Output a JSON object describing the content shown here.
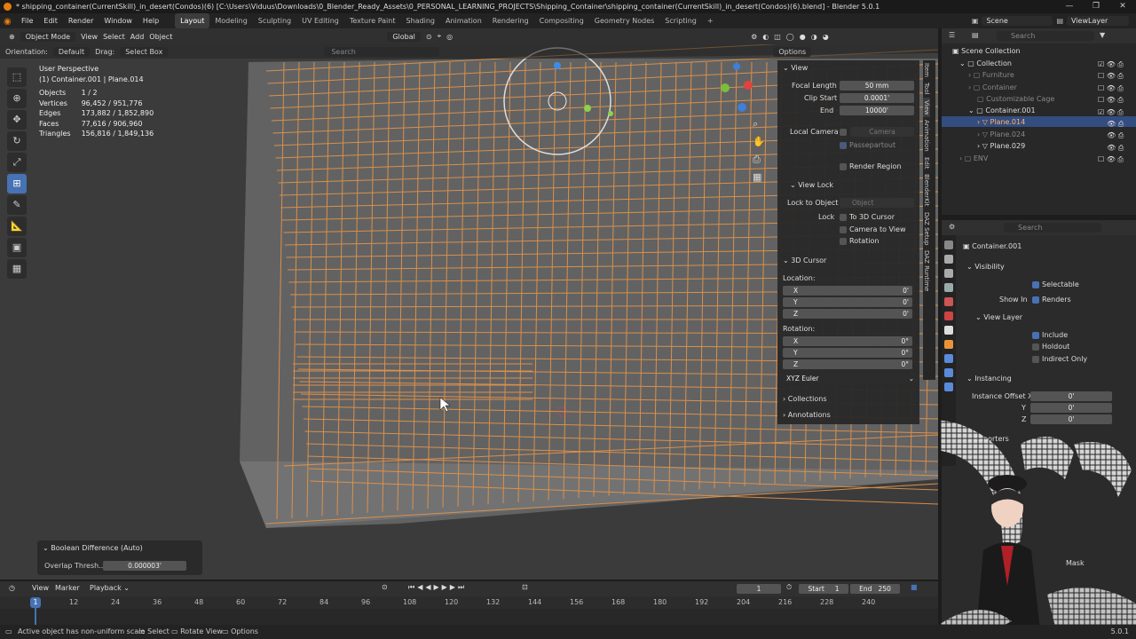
{
  "title": "* shipping_container(CurrentSkill)_in_desert(Condos)(6) [C:\\Users\\Viduus\\Downloads\\0_Blender_Ready_Assets\\0_PERSONAL_LEARNING_PROJECTS\\Shipping_Container\\shipping_container(CurrentSkill)_in_desert(Condos)(6).blend] - Blender 5.0.1",
  "window_controls": [
    "—",
    "❐",
    "✕"
  ],
  "menu": [
    "File",
    "Edit",
    "Render",
    "Window",
    "Help"
  ],
  "workspaces": [
    "Layout",
    "Modeling",
    "Sculpting",
    "UV Editing",
    "Texture Paint",
    "Shading",
    "Animation",
    "Rendering",
    "Compositing",
    "Geometry Nodes",
    "Scripting",
    "+"
  ],
  "scene": {
    "label": "Scene",
    "view_layer": "ViewLayer"
  },
  "viewport_header": {
    "mode": "Object Mode",
    "view": "View",
    "select": "Select",
    "add": "Add",
    "object": "Object",
    "transform": "Global"
  },
  "tool_settings": {
    "orientation_label": "Orientation:",
    "orientation": "Default",
    "drag_label": "Drag:",
    "drag": "Select Box",
    "search_placeholder": "Search",
    "options": "Options"
  },
  "overlay_info": {
    "perspective": "User Perspective",
    "object": "(1) Container.001 | Plane.014"
  },
  "stats": [
    {
      "label": "Objects",
      "value": "1 / 2"
    },
    {
      "label": "Vertices",
      "value": "96,452 / 951,776"
    },
    {
      "label": "Edges",
      "value": "173,882 / 1,852,890"
    },
    {
      "label": "Faces",
      "value": "77,616 / 906,960"
    },
    {
      "label": "Triangles",
      "value": "156,816 / 1,849,136"
    }
  ],
  "npanel": {
    "view_header": "View",
    "focal_label": "Focal Length",
    "focal_value": "50 mm",
    "clip_start_label": "Clip Start",
    "clip_start_value": "0.0001'",
    "end_label": "End",
    "end_value": "10000'",
    "local_camera_label": "Local Camera",
    "camera_placeholder": "Camera",
    "passepartout": "Passepartout",
    "render_region": "Render Region",
    "view_lock_header": "View Lock",
    "lock_object_label": "Lock to Object",
    "object_placeholder": "Object",
    "lock_label": "Lock",
    "to_3d_cursor": "To 3D Cursor",
    "camera_to_view": "Camera to View",
    "rotation_lock": "Rotation",
    "cursor_header": "3D Cursor",
    "location_label": "Location:",
    "loc": [
      {
        "axis": "X",
        "value": "0'"
      },
      {
        "axis": "Y",
        "value": "0'"
      },
      {
        "axis": "Z",
        "value": "0'"
      }
    ],
    "rotation_label": "Rotation:",
    "rot": [
      {
        "axis": "X",
        "value": "0°"
      },
      {
        "axis": "Y",
        "value": "0°"
      },
      {
        "axis": "Z",
        "value": "0°"
      }
    ],
    "euler": "XYZ Euler",
    "collections": "Collections",
    "annotations": "Annotations"
  },
  "ntabs": [
    "Item",
    "Tool",
    "View",
    "Animation",
    "Edit",
    "BlenderKit",
    "DAZ Setup",
    "DAZ Runtime"
  ],
  "outliner": {
    "search_placeholder": "Search",
    "items": [
      {
        "label": "Scene Collection"
      },
      {
        "label": "Collection"
      },
      {
        "label": "Furniture"
      },
      {
        "label": "Container"
      },
      {
        "label": "Customizable Cage"
      },
      {
        "label": "Container.001"
      },
      {
        "label": "Plane.014"
      },
      {
        "label": "Plane.024"
      },
      {
        "label": "Plane.029"
      },
      {
        "label": "ENV"
      }
    ]
  },
  "properties": {
    "search_placeholder": "Search",
    "object_name": "Container.001",
    "visibility": "Visibility",
    "selectable": "Selectable",
    "show_in": "Show In",
    "renders": "Renders",
    "view_layer": "View Layer",
    "include": "Include",
    "holdout": "Holdout",
    "indirect_only": "Indirect Only",
    "instancing": "Instancing",
    "instance_offset": "Instance Offset X",
    "y_label": "Y",
    "z_label": "Z",
    "offset_x": "0'",
    "offset_y": "0'",
    "offset_z": "0'",
    "exporters": "Exporters",
    "mask": "Mask"
  },
  "operator_panel": {
    "title": "Boolean Difference (Auto)",
    "label": "Overlap Thresh...",
    "value": "0.000003'"
  },
  "timeline": {
    "view": "View",
    "marker": "Marker",
    "playback": "Playback",
    "current_frame": "1",
    "start_label": "Start",
    "start": "1",
    "end_label": "End",
    "end": "250",
    "ticks": [
      "12",
      "24",
      "36",
      "48",
      "60",
      "72",
      "84",
      "96",
      "108",
      "120",
      "132",
      "144",
      "156",
      "168",
      "180",
      "192",
      "204",
      "216",
      "228",
      "240"
    ],
    "playhead": "1"
  },
  "status": {
    "message": "Active object has non-uniform scale",
    "select": "Select",
    "rotate": "Rotate View",
    "options": "Options",
    "version": "5.0.1"
  },
  "colors": {
    "accent": "#4772b3",
    "wire": "#e6954a",
    "active_tab": "#3c3c3c"
  }
}
